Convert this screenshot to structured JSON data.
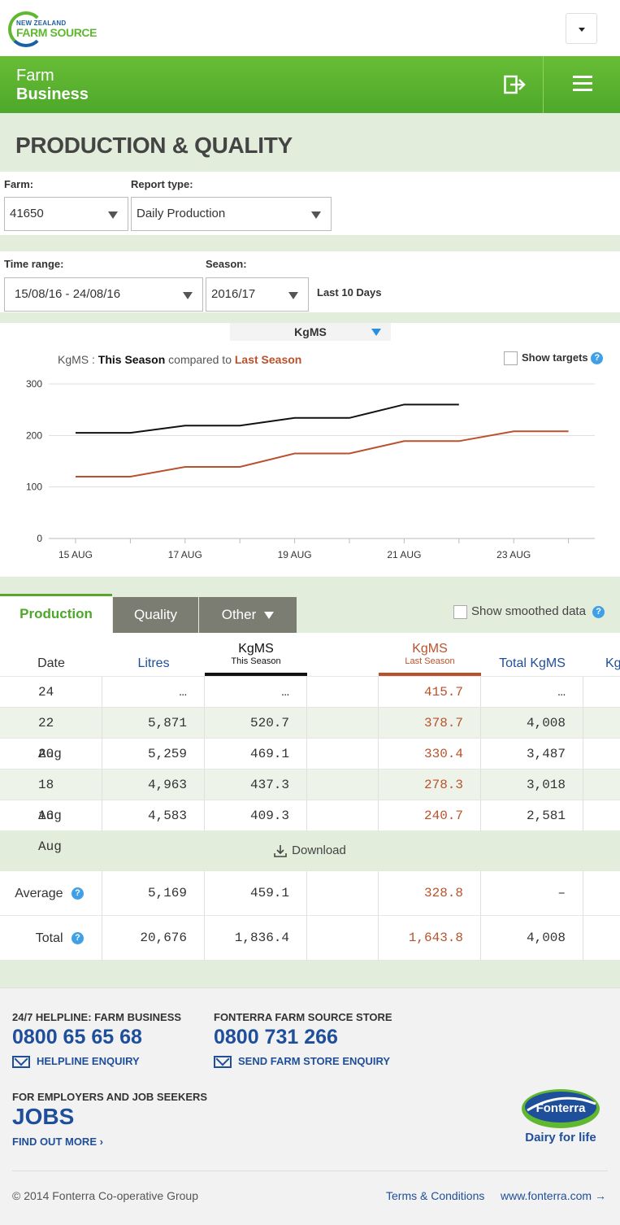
{
  "header": {
    "logo_top": "NEW ZEALAND",
    "logo_main": "FARM SOURCE",
    "section_line1": "Farm",
    "section_line2": "Business"
  },
  "page_title": "PRODUCTION & QUALITY",
  "filters": {
    "farm_label": "Farm:",
    "farm_value": "41650",
    "report_label": "Report type:",
    "report_value": "Daily Production",
    "time_label": "Time range:",
    "time_value": "15/08/16 - 24/08/16",
    "season_label": "Season:",
    "season_value": "2016/17",
    "range_note": "Last 10 Days"
  },
  "chart_header": {
    "metric": "KgMS",
    "subtitle_prefix": "KgMS : ",
    "this_season": "This Season",
    "compared": " compared to ",
    "last_season": "Last Season",
    "show_targets": "Show targets"
  },
  "chart_data": {
    "type": "line",
    "x": [
      "15 AUG",
      "16 AUG",
      "17 AUG",
      "18 AUG",
      "19 AUG",
      "20 AUG",
      "21 AUG",
      "22 AUG",
      "23 AUG",
      "24 AUG"
    ],
    "tick_labels": [
      "15 AUG",
      "17 AUG",
      "19 AUG",
      "21 AUG",
      "23 AUG"
    ],
    "ylim": [
      0,
      300
    ],
    "yticks": [
      0,
      100,
      200,
      300
    ],
    "grid": true,
    "series": [
      {
        "name": "This Season",
        "color": "#111111",
        "values": [
          205,
          205,
          219,
          219,
          234,
          234,
          260,
          260,
          null,
          null
        ]
      },
      {
        "name": "Last Season",
        "color": "#b9522c",
        "values": [
          120,
          120,
          139,
          139,
          165,
          165,
          189,
          189,
          208,
          208
        ]
      }
    ]
  },
  "tabs": {
    "production": "Production",
    "quality": "Quality",
    "other": "Other",
    "smoothed": "Show smoothed data"
  },
  "table": {
    "headers": {
      "date": "Date",
      "litres": "Litres",
      "kgms_ts": "KgMS",
      "kgms_ts_sub": "This Season",
      "kgms_ls": "KgMS",
      "kgms_ls_sub": "Last Season",
      "total": "Total KgMS",
      "cut": "Kg"
    },
    "rows": [
      {
        "date": "24  Aug",
        "litres": "…",
        "ts": "…",
        "ls": "415.7",
        "total": "…"
      },
      {
        "date": "22  Aug",
        "litres": "5,871",
        "ts": "520.7",
        "ls": "378.7",
        "total": "4,008"
      },
      {
        "date": "20  Aug",
        "litres": "5,259",
        "ts": "469.1",
        "ls": "330.4",
        "total": "3,487"
      },
      {
        "date": "18  Aug",
        "litres": "4,963",
        "ts": "437.3",
        "ls": "278.3",
        "total": "3,018"
      },
      {
        "date": "16  Aug",
        "litres": "4,583",
        "ts": "409.3",
        "ls": "240.7",
        "total": "2,581"
      }
    ],
    "download": "Download",
    "average": {
      "label": "Average",
      "litres": "5,169",
      "ts": "459.1",
      "ls": "328.8",
      "total": "–"
    },
    "total": {
      "label": "Total",
      "litres": "20,676",
      "ts": "1,836.4",
      "ls": "1,643.8",
      "total": "4,008"
    }
  },
  "footer": {
    "helpline_title": "24/7 HELPLINE: FARM BUSINESS",
    "helpline_phone": "0800 65 65 68",
    "helpline_link": "HELPLINE ENQUIRY",
    "store_title": "FONTERRA FARM SOURCE STORE",
    "store_phone": "0800 731 266",
    "store_link": "SEND FARM STORE ENQUIRY",
    "jobs_title": "FOR EMPLOYERS AND JOB SEEKERS",
    "jobs": "JOBS",
    "jobs_link": "FIND OUT MORE",
    "brand": "Fonterra",
    "tagline": "Dairy for life",
    "copyright": "© 2014 Fonterra Co-operative Group",
    "terms": "Terms & Conditions",
    "site": "www.fonterra.com"
  }
}
